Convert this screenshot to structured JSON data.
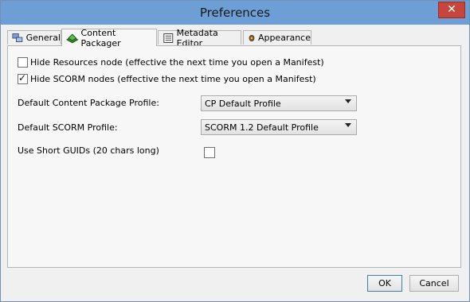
{
  "window": {
    "title": "Preferences",
    "close_glyph": "✕"
  },
  "tabs": [
    {
      "label": "General",
      "icon": "general-icon"
    },
    {
      "label": "Content Packager",
      "icon": "content-packager-icon"
    },
    {
      "label": "Metadata Editor",
      "icon": "metadata-editor-icon"
    },
    {
      "label": "Appearance",
      "icon": "appearance-icon"
    }
  ],
  "content_packager": {
    "hide_resources": {
      "label": "Hide Resources node (effective the next time you open a Manifest)",
      "checked": false
    },
    "hide_scorm": {
      "label": "Hide SCORM nodes (effective the next time you open a Manifest)",
      "checked": true
    },
    "default_cp_profile": {
      "label": "Default Content Package Profile:",
      "value": "CP Default Profile"
    },
    "default_scorm_profile": {
      "label": "Default SCORM Profile:",
      "value": "SCORM 1.2 Default Profile"
    },
    "short_guids": {
      "label": "Use Short GUIDs (20 chars long)",
      "checked": false
    }
  },
  "buttons": {
    "ok": "OK",
    "cancel": "Cancel"
  }
}
